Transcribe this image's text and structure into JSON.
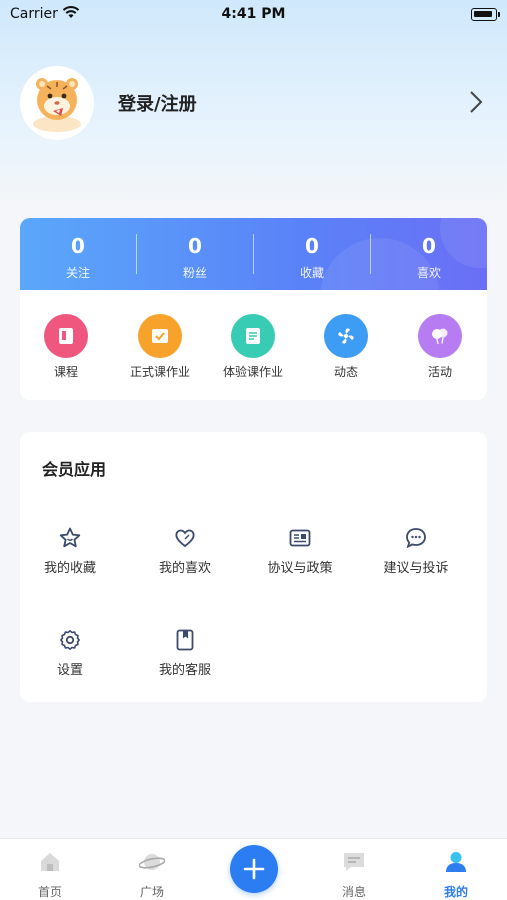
{
  "status_bar": {
    "carrier": "Carrier",
    "time": "4:41 PM"
  },
  "profile": {
    "login_label": "登录/注册"
  },
  "stats": [
    {
      "value": "0",
      "label": "关注"
    },
    {
      "value": "0",
      "label": "粉丝"
    },
    {
      "value": "0",
      "label": "收藏"
    },
    {
      "value": "0",
      "label": "喜欢"
    }
  ],
  "quick_actions": [
    {
      "label": "课程",
      "icon": "book-icon",
      "color": "#f0577f"
    },
    {
      "label": "正式课作业",
      "icon": "homework-check-icon",
      "color": "#f7a22b"
    },
    {
      "label": "体验课作业",
      "icon": "document-edit-icon",
      "color": "#38ccb4"
    },
    {
      "label": "动态",
      "icon": "fan-icon",
      "color": "#3d9cf3"
    },
    {
      "label": "活动",
      "icon": "balloon-icon",
      "color": "#b77cf1"
    }
  ],
  "member_apps": {
    "title": "会员应用",
    "items": [
      {
        "label": "我的收藏",
        "icon": "star-icon"
      },
      {
        "label": "我的喜欢",
        "icon": "heart-icon"
      },
      {
        "label": "协议与政策",
        "icon": "id-card-icon"
      },
      {
        "label": "建议与投诉",
        "icon": "chat-bubble-icon"
      },
      {
        "label": "设置",
        "icon": "gear-icon"
      },
      {
        "label": "我的客服",
        "icon": "bookmark-book-icon"
      }
    ]
  },
  "tab_bar": [
    {
      "label": "首页",
      "icon": "home-icon"
    },
    {
      "label": "广场",
      "icon": "planet-icon"
    },
    {
      "label": "",
      "icon": "plus-icon"
    },
    {
      "label": "消息",
      "icon": "message-icon"
    },
    {
      "label": "我的",
      "icon": "user-icon",
      "active": true
    }
  ],
  "colors": {
    "accent": "#2b7df1",
    "stats_gradient_start": "#5aa8fa",
    "stats_gradient_end": "#6b6ff5"
  }
}
